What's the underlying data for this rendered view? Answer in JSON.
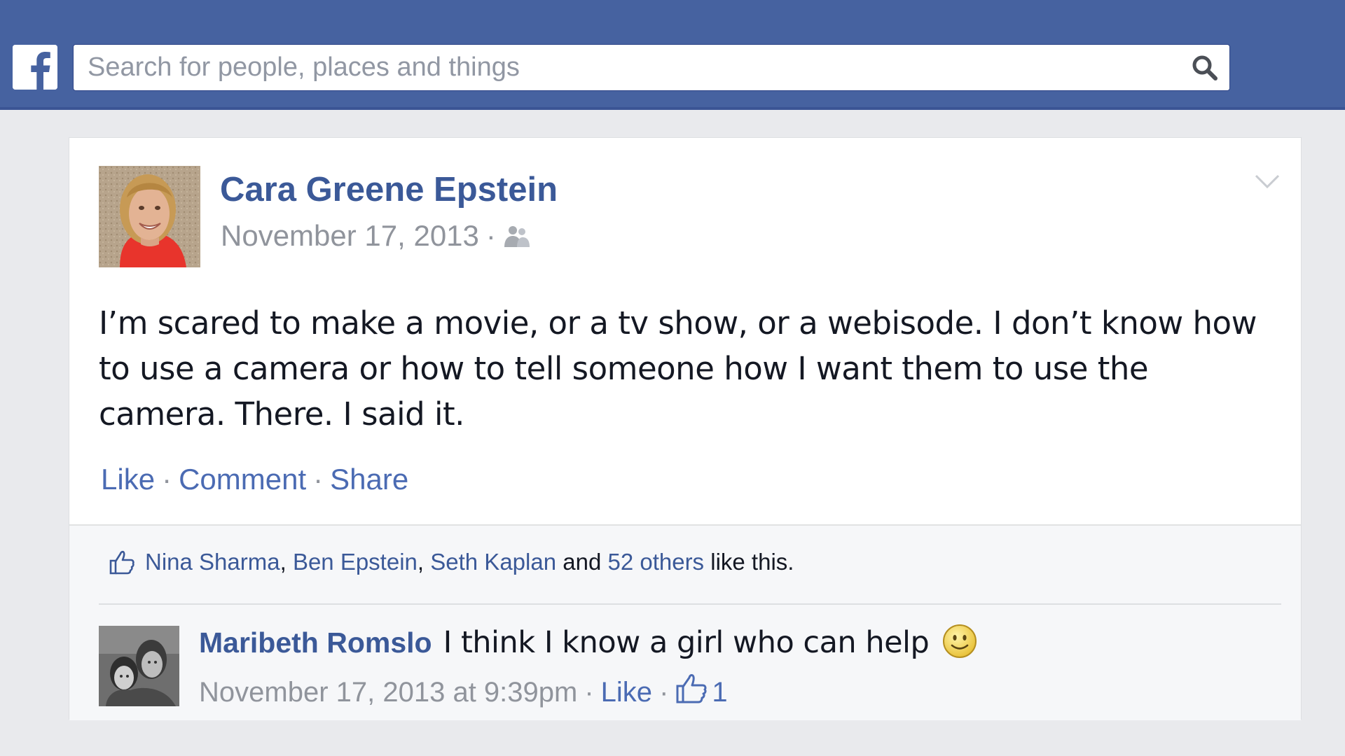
{
  "header": {
    "logo_icon": "facebook-logo-icon",
    "search": {
      "placeholder": "Search for people, places and things",
      "value": "",
      "icon": "search-icon"
    }
  },
  "post": {
    "author": "Cara Greene Epstein",
    "date": "November 17, 2013",
    "meta_separator": "·",
    "audience_icon": "friends-icon",
    "menu_icon": "chevron-down-icon",
    "text": "I’m scared to make a movie, or a tv show, or a webisode. I don’t know how to use a camera or how to tell someone how I want them to use the camera. There. I said it.",
    "actions": {
      "like": "Like",
      "comment": "Comment",
      "share": "Share",
      "separator": "·"
    }
  },
  "likes": {
    "icon": "thumbs-up-icon",
    "people": [
      "Nina Sharma",
      "Ben Epstein",
      "Seth Kaplan"
    ],
    "comma": ",",
    "and": "and",
    "others": "52 others",
    "suffix": "like this."
  },
  "comment": {
    "author": "Maribeth Romslo",
    "text": "I think I know a girl who can help",
    "emoji_icon": "smiley-icon",
    "timestamp": "November 17, 2013 at 9:39pm",
    "separator": "·",
    "like_label": "Like",
    "like_icon": "thumbs-up-icon",
    "like_count": "1"
  },
  "colors": {
    "header_blue": "#4662a0",
    "link_blue": "#3b5998",
    "meta_gray": "#90949c",
    "page_bg": "#e9eaed"
  }
}
